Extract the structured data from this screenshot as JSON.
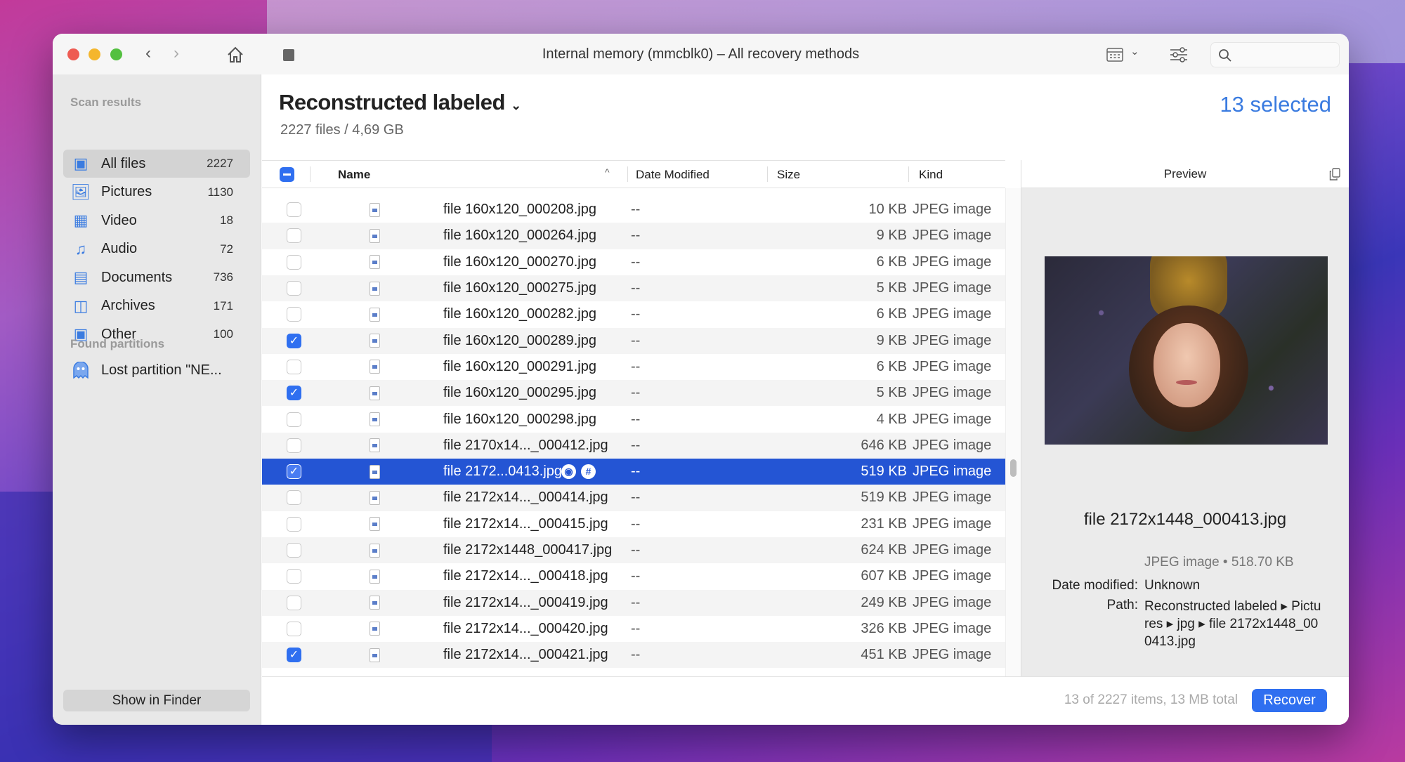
{
  "window": {
    "title": "Internal memory (mmcblk0) – All recovery methods"
  },
  "toolbar": {
    "icons": [
      "back-icon",
      "forward-icon",
      "home-icon",
      "stop-icon",
      "view-mode-icon",
      "filter-icon",
      "search-icon"
    ],
    "search_placeholder": ""
  },
  "sidebar": {
    "scan_results_label": "Scan results",
    "items": [
      {
        "label": "All files",
        "count": "2227",
        "icon": "all-files-icon",
        "active": true
      },
      {
        "label": "Pictures",
        "count": "1130",
        "icon": "pictures-icon"
      },
      {
        "label": "Video",
        "count": "18",
        "icon": "video-icon"
      },
      {
        "label": "Audio",
        "count": "72",
        "icon": "audio-icon"
      },
      {
        "label": "Documents",
        "count": "736",
        "icon": "documents-icon"
      },
      {
        "label": "Archives",
        "count": "171",
        "icon": "archives-icon"
      },
      {
        "label": "Other",
        "count": "100",
        "icon": "other-icon"
      }
    ],
    "found_partitions_label": "Found partitions",
    "partitions": [
      {
        "label": "Lost partition \"NE...",
        "icon": "ghost-icon"
      }
    ],
    "show_in_finder": "Show in Finder"
  },
  "header": {
    "title": "Reconstructed labeled",
    "subtitle": "2227 files / 4,69 GB",
    "selected": "13 selected"
  },
  "table": {
    "columns": {
      "name": "Name",
      "date": "Date Modified",
      "size": "Size",
      "kind": "Kind"
    },
    "rows": [
      {
        "name": "file 160x120_000208.jpg",
        "date": "--",
        "size": "10 KB",
        "kind": "JPEG image",
        "checked": false
      },
      {
        "name": "file 160x120_000264.jpg",
        "date": "--",
        "size": "9 KB",
        "kind": "JPEG image",
        "checked": false
      },
      {
        "name": "file 160x120_000270.jpg",
        "date": "--",
        "size": "6 KB",
        "kind": "JPEG image",
        "checked": false
      },
      {
        "name": "file 160x120_000275.jpg",
        "date": "--",
        "size": "5 KB",
        "kind": "JPEG image",
        "checked": false
      },
      {
        "name": "file 160x120_000282.jpg",
        "date": "--",
        "size": "6 KB",
        "kind": "JPEG image",
        "checked": false
      },
      {
        "name": "file 160x120_000289.jpg",
        "date": "--",
        "size": "9 KB",
        "kind": "JPEG image",
        "checked": true
      },
      {
        "name": "file 160x120_000291.jpg",
        "date": "--",
        "size": "6 KB",
        "kind": "JPEG image",
        "checked": false
      },
      {
        "name": "file 160x120_000295.jpg",
        "date": "--",
        "size": "5 KB",
        "kind": "JPEG image",
        "checked": true
      },
      {
        "name": "file 160x120_000298.jpg",
        "date": "--",
        "size": "4 KB",
        "kind": "JPEG image",
        "checked": false
      },
      {
        "name": "file 2170x14..._000412.jpg",
        "date": "--",
        "size": "646 KB",
        "kind": "JPEG image",
        "checked": false
      },
      {
        "name": "file 2172...0413.jpg",
        "date": "--",
        "size": "519 KB",
        "kind": "JPEG image",
        "checked": true,
        "selected": true
      },
      {
        "name": "file 2172x14..._000414.jpg",
        "date": "--",
        "size": "519 KB",
        "kind": "JPEG image",
        "checked": false
      },
      {
        "name": "file 2172x14..._000415.jpg",
        "date": "--",
        "size": "231 KB",
        "kind": "JPEG image",
        "checked": false
      },
      {
        "name": "file 2172x1448_000417.jpg",
        "date": "--",
        "size": "624 KB",
        "kind": "JPEG image",
        "checked": false
      },
      {
        "name": "file 2172x14..._000418.jpg",
        "date": "--",
        "size": "607 KB",
        "kind": "JPEG image",
        "checked": false
      },
      {
        "name": "file 2172x14..._000419.jpg",
        "date": "--",
        "size": "249 KB",
        "kind": "JPEG image",
        "checked": false
      },
      {
        "name": "file 2172x14..._000420.jpg",
        "date": "--",
        "size": "326 KB",
        "kind": "JPEG image",
        "checked": false
      },
      {
        "name": "file 2172x14..._000421.jpg",
        "date": "--",
        "size": "451 KB",
        "kind": "JPEG image",
        "checked": true
      }
    ]
  },
  "preview": {
    "header": "Preview",
    "filename": "file 2172x1448_000413.jpg",
    "kind_size": "JPEG image • 518.70 KB",
    "date_label": "Date modified:",
    "date_value": "Unknown",
    "path_label": "Path:",
    "path_value": "Reconstructed labeled ▸ Pictures ▸ jpg ▸ file 2172x1448_000413.jpg"
  },
  "footer": {
    "status": "13 of 2227 items, 13 MB total",
    "recover": "Recover"
  },
  "colors": {
    "accent": "#2f6ff0",
    "selection": "#2455d4",
    "selected_text": "#3a7be0"
  }
}
